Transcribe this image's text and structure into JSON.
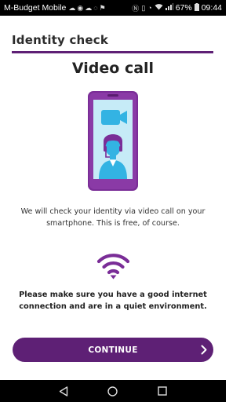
{
  "status_bar": {
    "carrier": "M-Budget Mobile",
    "battery": "67%",
    "time": "09:44",
    "left_icons": [
      "cloud-icon",
      "chat-icon",
      "cloud-icon",
      "sync-icon",
      "alarm-icon"
    ],
    "right_icons": [
      "nfc-icon",
      "vibrate-icon",
      "alarm-clock-icon",
      "wifi-icon",
      "signal-icon",
      "battery-icon"
    ]
  },
  "header": {
    "title": "Identity check"
  },
  "main": {
    "title": "Video call",
    "description": "We will check your identity via video call on your smartphone. This is free, of course.",
    "notice": "Please make sure you have a good internet connection and are in a quiet environment.",
    "illustration_icons": [
      "phone-icon",
      "video-camera-icon",
      "agent-headset-icon"
    ],
    "connection_icon": "wifi-icon"
  },
  "button": {
    "label": "CONTINUE"
  },
  "navigation": {
    "items": [
      "back-icon",
      "home-icon",
      "recents-icon"
    ]
  },
  "colors": {
    "brand_purple": "#5e2075",
    "phone_purple": "#7a2d97",
    "screen_blue": "#c6ebf7",
    "icon_blue": "#33b3e3"
  }
}
